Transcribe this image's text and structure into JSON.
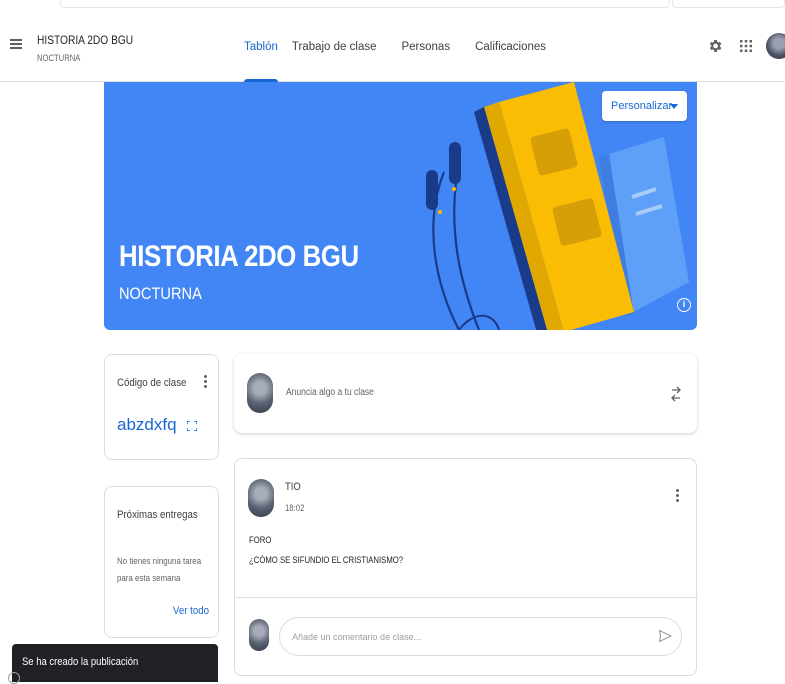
{
  "header": {
    "class_title": "HISTORIA 2DO BGU",
    "class_section": "NOCTURNA",
    "tabs": [
      {
        "label": "Tablón",
        "active": true
      },
      {
        "label": "Trabajo de clase",
        "active": false
      },
      {
        "label": "Personas",
        "active": false
      },
      {
        "label": "Calificaciones",
        "active": false
      }
    ],
    "icons": [
      "menu-icon",
      "gear-icon",
      "apps-grid-icon",
      "account-avatar"
    ]
  },
  "banner": {
    "title": "HISTORIA 2DO BGU",
    "subtitle": "NOCTURNA",
    "customize_label": "Personalizar",
    "background_color": "#4285f4"
  },
  "class_code": {
    "label": "Código de clase",
    "value": "abzdxfq"
  },
  "upcoming": {
    "title": "Próximas entregas",
    "empty_text": "No tienes ninguna tarea para esta semana",
    "view_all_label": "Ver todo"
  },
  "announce": {
    "placeholder": "Anuncia algo a tu clase"
  },
  "post": {
    "author": "TIO",
    "time": "18:02",
    "line1": "FORO",
    "line2": "¿CÓMO SE SIFUNDIO EL CRISTIANISMO?",
    "comment_placeholder": "Añade un comentario de clase..."
  },
  "snackbar": {
    "text": "Se ha creado la publicación"
  },
  "colors": {
    "accent": "#1967d2",
    "banner": "#4285f4",
    "snackbar": "#202124"
  }
}
